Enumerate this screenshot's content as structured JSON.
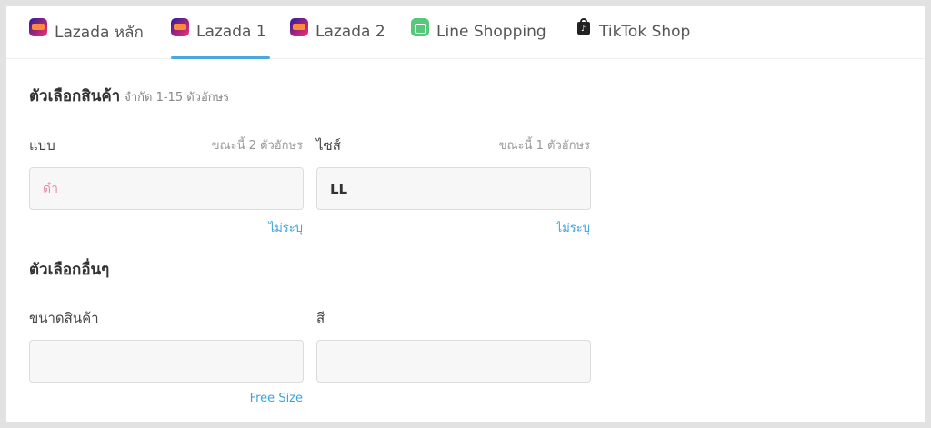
{
  "tabs": [
    {
      "label": "Lazada หลัก",
      "icon": "lazada-icon",
      "active": false
    },
    {
      "label": "Lazada 1",
      "icon": "lazada-icon",
      "active": true
    },
    {
      "label": "Lazada 2",
      "icon": "lazada-icon",
      "active": false
    },
    {
      "label": "Line Shopping",
      "icon": "line-shopping-icon",
      "active": false
    },
    {
      "label": "TikTok Shop",
      "icon": "tiktok-shop-icon",
      "active": false
    }
  ],
  "product_options": {
    "title": "ตัวเลือกสินค้า",
    "note": "จำกัด 1-15 ตัวอักษร",
    "model": {
      "label": "แบบ",
      "counter": "ขณะนี้ 2 ตัวอักษร",
      "value": "ดำ",
      "link": "ไม่ระบุ"
    },
    "size": {
      "label": "ไซส์",
      "counter": "ขณะนี้ 1 ตัวอักษร",
      "value": "LL",
      "link": "ไม่ระบุ"
    }
  },
  "other_options": {
    "title": "ตัวเลือกอื่นๆ",
    "product_size": {
      "label": "ขนาดสินค้า",
      "value": "",
      "link": "Free Size"
    },
    "color": {
      "label": "สี",
      "value": ""
    }
  },
  "colors": {
    "accent": "#4ba8df",
    "link": "#3aa4dc",
    "placeholder_text": "#e68aa8"
  }
}
